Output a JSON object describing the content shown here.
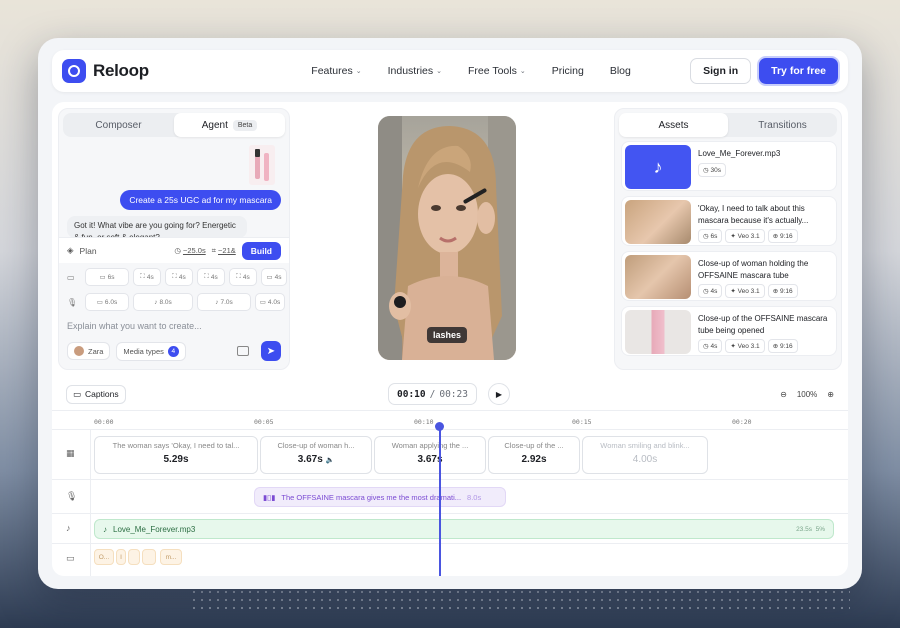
{
  "nav": {
    "brand": "Reloop",
    "menu": [
      "Features",
      "Industries",
      "Free Tools",
      "Pricing",
      "Blog"
    ],
    "sign_in": "Sign in",
    "try_free": "Try for free"
  },
  "composer": {
    "tab_composer": "Composer",
    "tab_agent": "Agent",
    "beta": "Beta",
    "user_message": "Create a 25s UGC ad for my mascara",
    "bot_message": "Got it! What vibe are you going for? Energetic & fun, or soft & elegant?",
    "plan_label": "Plan",
    "plan_duration": "~25.0s",
    "plan_ratio": "~21&",
    "build_label": "Build",
    "video_chips": [
      "6s",
      "4s",
      "4s",
      "4s",
      "4s",
      "4s"
    ],
    "audio_chips": [
      "6.0s",
      "8.0s",
      "7.0s",
      "4.0s"
    ],
    "placeholder": "Explain what you want to create...",
    "avatar_name": "Zara",
    "media_types_label": "Media types",
    "media_types_count": "4"
  },
  "preview": {
    "caption": "lashes"
  },
  "assets": {
    "tab_assets": "Assets",
    "tab_transitions": "Transitions",
    "items": [
      {
        "title": "Love_Me_Forever.mp3",
        "duration": "30s"
      },
      {
        "title": "'Okay, I need to talk about this mascara because it's actually...",
        "duration": "6s",
        "model": "Veo 3.1",
        "ratio": "9:16"
      },
      {
        "title": "Close-up of woman holding the OFFSAINE mascara tube",
        "duration": "4s",
        "model": "Veo 3.1",
        "ratio": "9:16"
      },
      {
        "title": "Close-up of the OFFSAINE mascara tube being opened",
        "duration": "4s",
        "model": "Veo 3.1",
        "ratio": "9:16"
      }
    ]
  },
  "timeline": {
    "captions_label": "Captions",
    "current_time": "00:10",
    "separator": "/",
    "total_time": "00:23",
    "zoom": "100%",
    "ruler": [
      "00:00",
      "00:05",
      "00:10",
      "00:15",
      "00:20"
    ],
    "video_clips": [
      {
        "desc": "The woman says 'Okay, I need to tal...",
        "dur": "5.29s"
      },
      {
        "desc": "Close-up of woman h...",
        "dur": "3.67s"
      },
      {
        "desc": "Woman applying the ...",
        "dur": "3.67s"
      },
      {
        "desc": "Close-up of the ...",
        "dur": "2.92s"
      },
      {
        "desc": "Woman smiling and blink...",
        "dur": "4.00s"
      }
    ],
    "voice_clip": {
      "text": "The OFFSAINE mascara gives me the most dramati...",
      "dur": "8.0s"
    },
    "music_clip": {
      "name": "Love_Me_Forever.mp3",
      "dur": "23.5s",
      "vol": "5%"
    },
    "caption_clips": [
      "O...",
      "I",
      "",
      "",
      "m..."
    ]
  },
  "colors": {
    "accent": "#3d4df0",
    "voice": "#7b4bd3",
    "music": "#2c6e43"
  }
}
